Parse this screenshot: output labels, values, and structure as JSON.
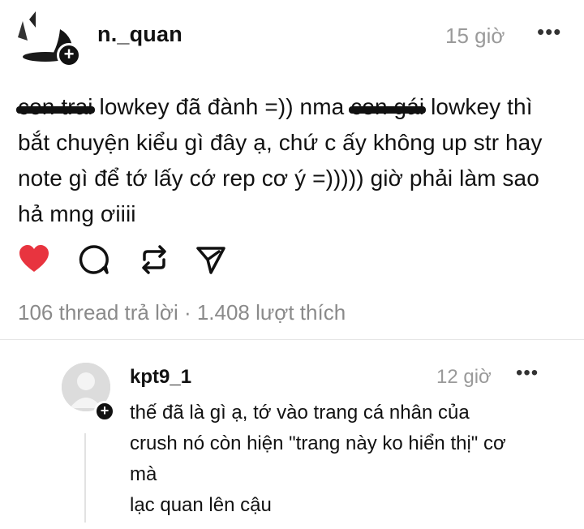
{
  "post": {
    "username": "n._quan",
    "time": "15 giờ",
    "more": "•••",
    "body": {
      "scribbled_1": "con trai",
      "text_1": " lowkey đã đành =)) nma ",
      "scribbled_2": "con gái",
      "text_2": " lowkey thì bắt chuyện kiểu gì đây ạ, chứ c ấy không up str hay note gì để tớ lấy cớ rep cơ ý =))))) giờ phải làm sao hả mng ơiiii"
    },
    "stats": "106 thread trả lời · 1.408 lượt thích",
    "icons": {
      "like": "heart-icon",
      "comment": "comment-icon",
      "repost": "repost-icon",
      "share": "send-icon"
    },
    "like_color": "#e8343f"
  },
  "reply": {
    "username": "kpt9_1",
    "time": "12 giờ",
    "more": "•••",
    "lines": [
      "thế đã là gì ạ, tớ vào trang cá nhân của",
      "crush nó còn hiện \"trang này ko hiển thị\" cơ",
      "mà",
      "lạc quan lên cậu"
    ]
  }
}
